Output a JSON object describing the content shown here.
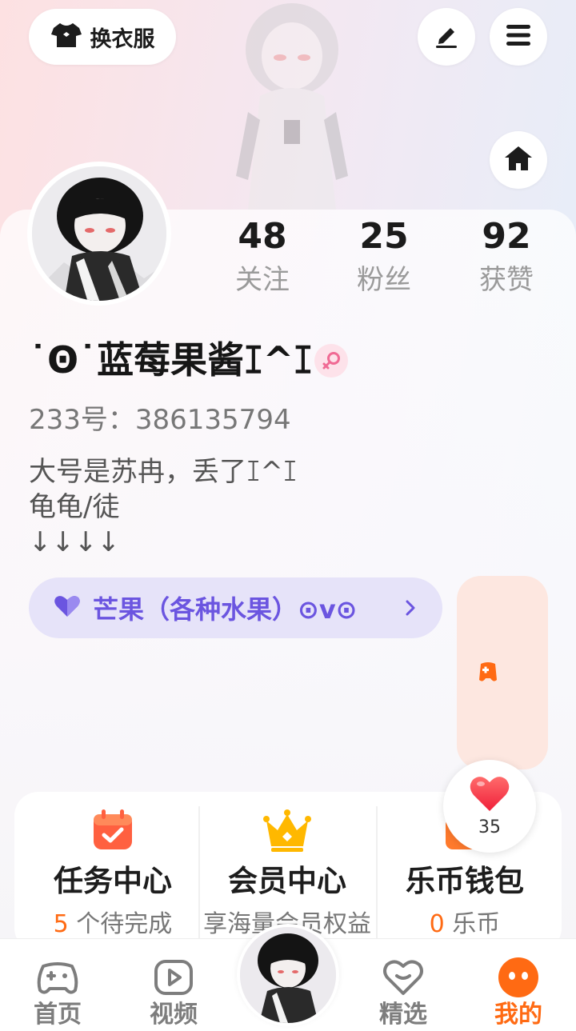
{
  "header": {
    "outfit_label": "换衣服",
    "edit_icon": "pencil-icon",
    "menu_icon": "hamburger-menu-icon",
    "home_icon": "house-icon"
  },
  "profile": {
    "stats": [
      {
        "value": "48",
        "label": "关注"
      },
      {
        "value": "25",
        "label": "粉丝"
      },
      {
        "value": "92",
        "label": "获赞"
      }
    ],
    "username": "˙Ꙩ˙蓝莓果酱ꕯ^ꕯ",
    "gender": "female",
    "uid": "233号：386135794",
    "bio": "大号是苏冉，丢了ꕯ^ꕯ\n龟龟/徒\n↓↓↓↓",
    "medal": "芒果（各种水果）⊙v⊙"
  },
  "shortcuts": [
    {
      "title": "任务中心",
      "sub_highlight": "5",
      "sub": " 个待完成",
      "icon": "calendar-check-icon"
    },
    {
      "title": "会员中心",
      "sub_highlight": "",
      "sub": "享海量会员权益",
      "icon": "crown-icon"
    },
    {
      "title": "乐币钱包",
      "sub_highlight": "0",
      "sub": " 乐币",
      "icon": "wallet-icon"
    }
  ],
  "like_float": {
    "count": "35"
  },
  "nav": [
    {
      "label": "首页",
      "icon": "gamepad-icon"
    },
    {
      "label": "视频",
      "icon": "play-icon"
    },
    {
      "label": "精选",
      "icon": "heart-chat-icon"
    },
    {
      "label": "我的",
      "icon": "mine-face-icon"
    }
  ],
  "colors": {
    "accent": "#ff6a13",
    "medal_text": "#6b55e0",
    "medal_bg": "#e6e3f9"
  }
}
